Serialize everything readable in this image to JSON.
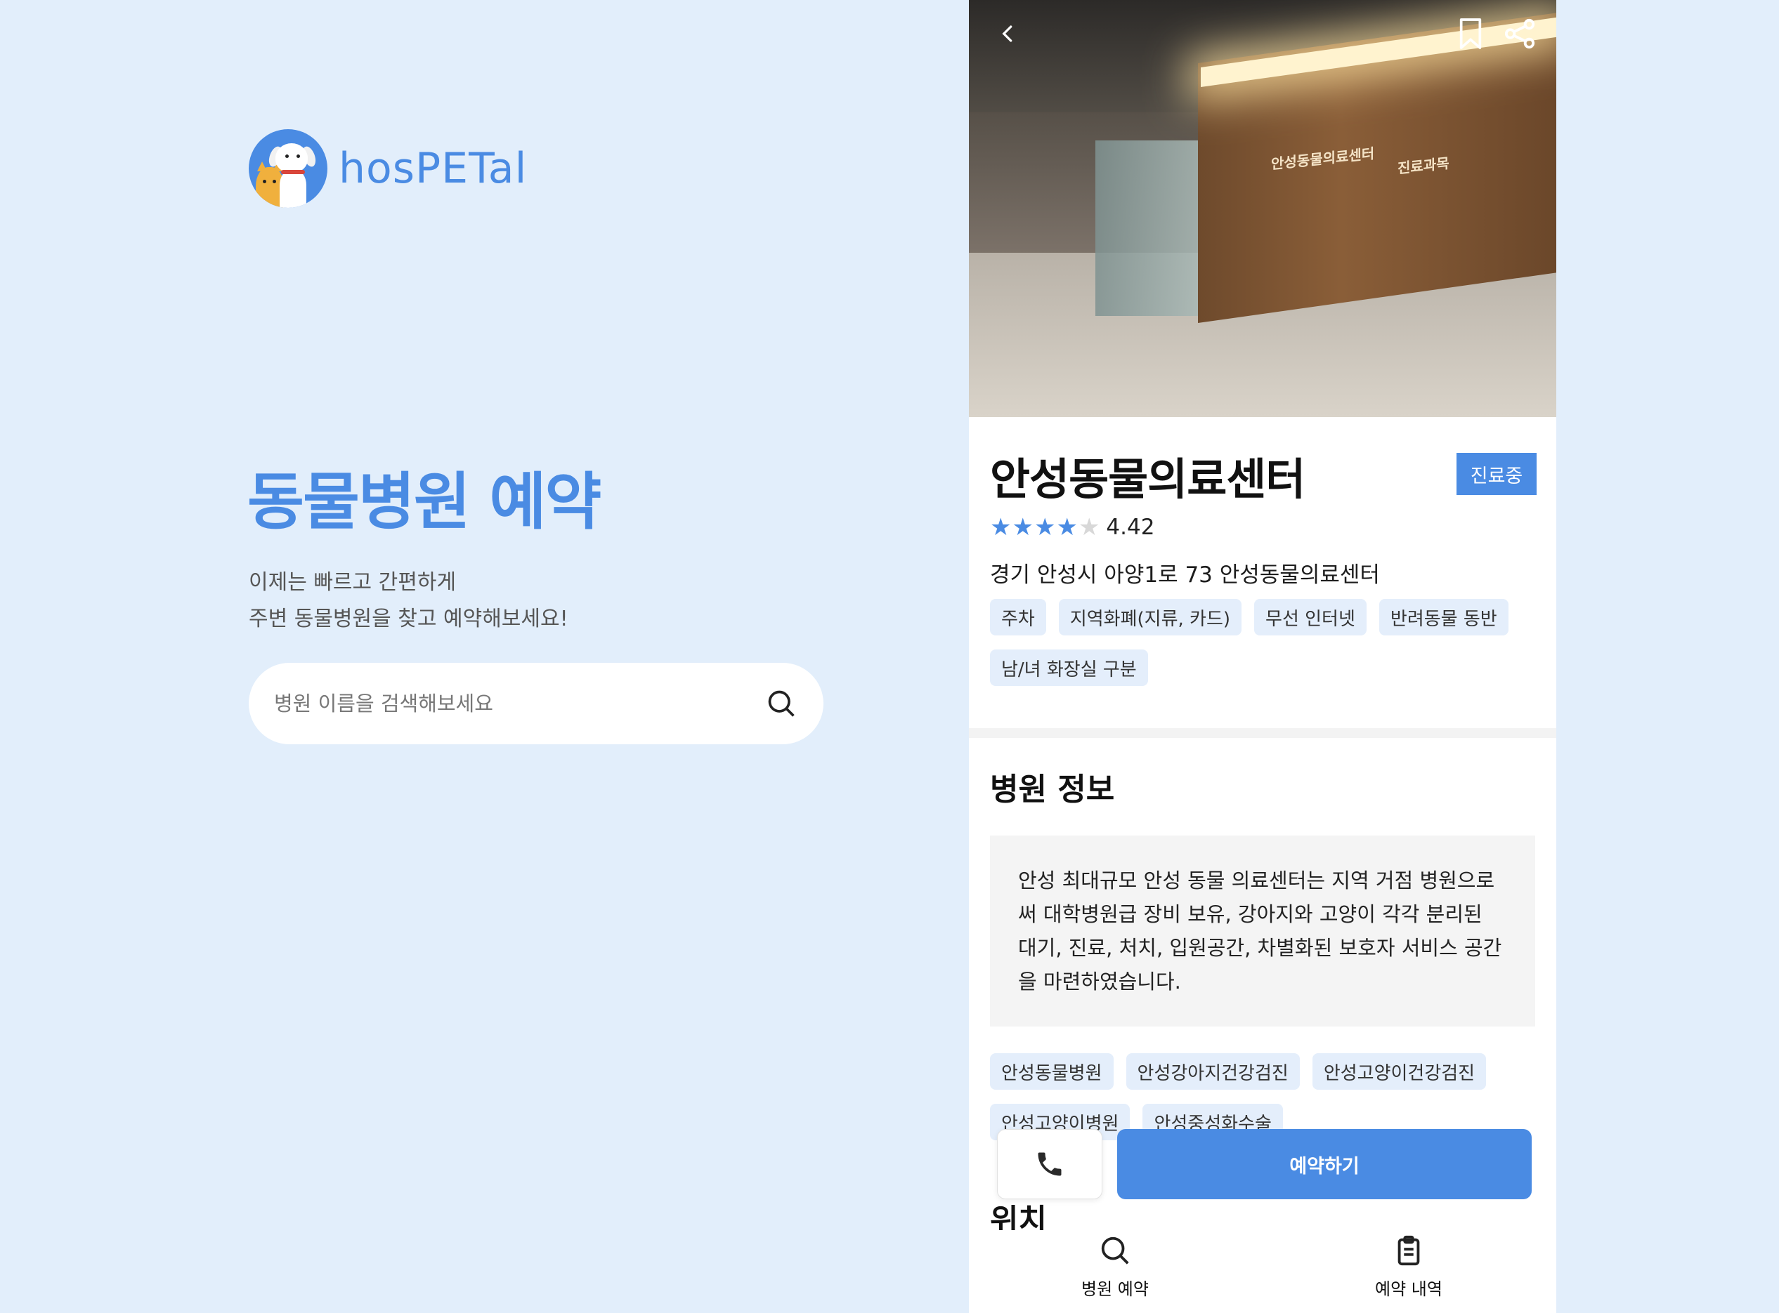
{
  "brand": {
    "name": "hosPETal",
    "accent": "#4a8be3"
  },
  "landing": {
    "title": "동물병원 예약",
    "subtitle_line1": "이제는 빠르고 간편하게",
    "subtitle_line2": "주변 동물병원을 찾고 예약해보세요!",
    "search_placeholder": "병원 이름을 검색해보세요",
    "search_icon": "search-icon"
  },
  "detail": {
    "top_nav": {
      "back_icon": "chevron-left-icon",
      "bookmark_icon": "bookmark-icon",
      "share_icon": "share-icon"
    },
    "photo_signs": {
      "sign1": "안성동물의료센터",
      "sign2": "진료과목"
    },
    "name": "안성동물의료센터",
    "status": "진료중",
    "rating": {
      "value": "4.42",
      "stars_filled": 4,
      "stars_total": 5
    },
    "address": "경기 안성시 아양1로 73 안성동물의료센터",
    "amenities": [
      "주차",
      "지역화폐(지류, 카드)",
      "무선 인터넷",
      "반려동물 동반",
      "남/녀 화장실 구분"
    ],
    "info_title": "병원 정보",
    "info_text": "안성 최대규모 안성 동물 의료센터는 지역 거점 병원으로써 대학병원급 장비 보유, 강아지와 고양이 각각 분리된 대기, 진료, 처치, 입원공간, 차별화된 보호자 서비스 공간을 마련하였습니다.",
    "tags": [
      "안성동물병원",
      "안성강아지건강검진",
      "안성고양이건강검진",
      "안성고양이병원",
      "안성중성화수술"
    ],
    "location_title": "위치",
    "call_icon": "phone-icon",
    "reserve_label": "예약하기"
  },
  "tabbar": {
    "tabs": [
      {
        "label": "병원 예약",
        "icon": "search-icon"
      },
      {
        "label": "예약 내역",
        "icon": "clipboard-icon"
      }
    ]
  }
}
